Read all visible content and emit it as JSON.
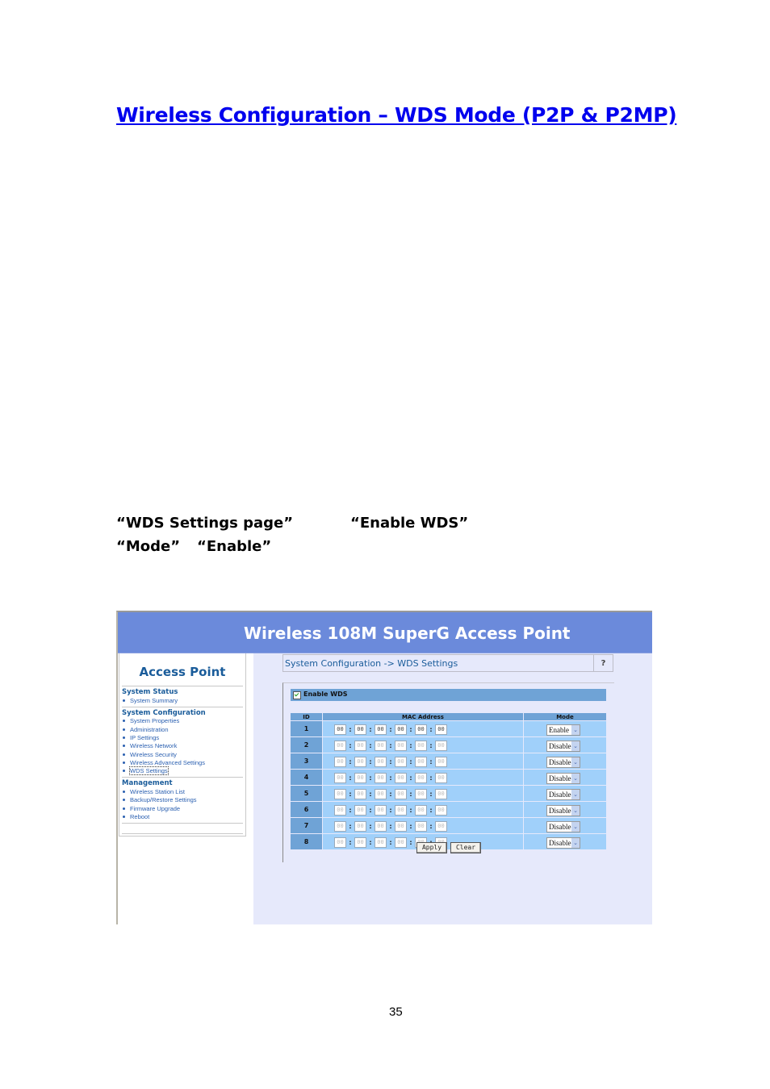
{
  "document": {
    "heading": "Wireless Configuration – WDS Mode (P2P & P2MP)",
    "instructions": [
      {
        "text": "“WDS Settings page”"
      },
      {
        "text": "“Enable WDS”"
      },
      {
        "text": "“Mode”"
      },
      {
        "text": "“Enable”"
      }
    ],
    "page_number": "35"
  },
  "screenshot": {
    "banner_title": "Wireless 108M SuperG Access Point",
    "sidebar": {
      "title": "Access Point",
      "sections": [
        {
          "title": "System Status",
          "items": [
            {
              "label": "System Summary"
            }
          ]
        },
        {
          "title": "System Configuration",
          "items": [
            {
              "label": "System Properties"
            },
            {
              "label": "Administration"
            },
            {
              "label": "IP Settings"
            },
            {
              "label": "Wireless Network"
            },
            {
              "label": "Wireless Security"
            },
            {
              "label": "Wireless Advanced Settings"
            },
            {
              "label": "WDS Settings",
              "active": true
            }
          ]
        },
        {
          "title": "Management",
          "items": [
            {
              "label": "Wireless Station List"
            },
            {
              "label": "Backup/Restore Settings"
            },
            {
              "label": "Firmware Upgrade"
            },
            {
              "label": "Reboot"
            }
          ]
        }
      ]
    },
    "breadcrumb": "System Configuration -> WDS Settings",
    "help_label": "?",
    "enable_wds": {
      "label": "Enable WDS",
      "checked": true
    },
    "table": {
      "headers": {
        "id": "ID",
        "mac": "MAC Address",
        "mode": "Mode"
      },
      "rows": [
        {
          "id": "1",
          "mac": [
            "00",
            "00",
            "00",
            "00",
            "00",
            "00"
          ],
          "mode": "Enable",
          "active": true
        },
        {
          "id": "2",
          "mac": [
            "00",
            "00",
            "00",
            "00",
            "00",
            "00"
          ],
          "mode": "Disable",
          "active": false
        },
        {
          "id": "3",
          "mac": [
            "00",
            "00",
            "00",
            "00",
            "00",
            "00"
          ],
          "mode": "Disable",
          "active": false
        },
        {
          "id": "4",
          "mac": [
            "00",
            "00",
            "00",
            "00",
            "00",
            "00"
          ],
          "mode": "Disable",
          "active": false
        },
        {
          "id": "5",
          "mac": [
            "00",
            "00",
            "00",
            "00",
            "00",
            "00"
          ],
          "mode": "Disable",
          "active": false
        },
        {
          "id": "6",
          "mac": [
            "00",
            "00",
            "00",
            "00",
            "00",
            "00"
          ],
          "mode": "Disable",
          "active": false
        },
        {
          "id": "7",
          "mac": [
            "00",
            "00",
            "00",
            "00",
            "00",
            "00"
          ],
          "mode": "Disable",
          "active": false
        },
        {
          "id": "8",
          "mac": [
            "00",
            "00",
            "00",
            "00",
            "00",
            "00"
          ],
          "mode": "Disable",
          "active": false
        }
      ],
      "separator": ":"
    },
    "buttons": {
      "apply": "Apply",
      "clear": "Clear"
    },
    "icons": {
      "dropdown_arrow": "⌄",
      "check": "checkmark-icon"
    }
  }
}
